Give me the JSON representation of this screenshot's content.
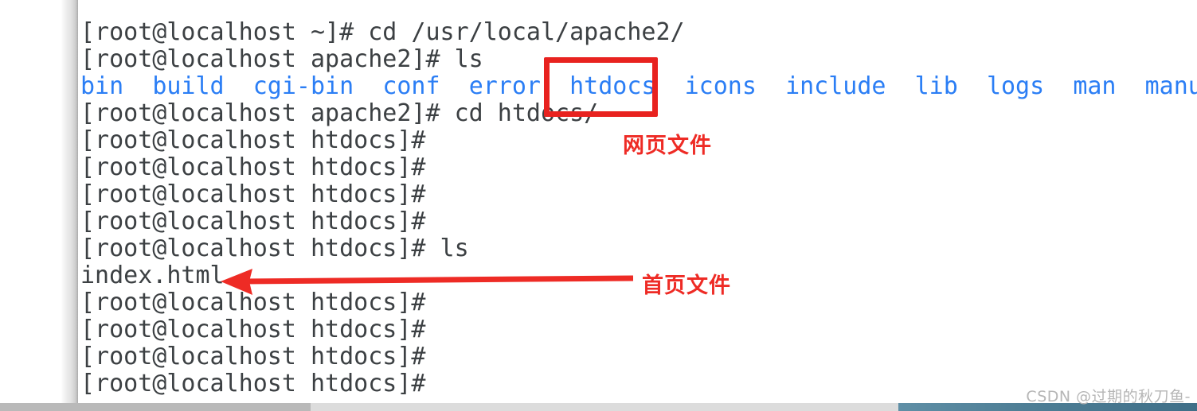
{
  "terminal": {
    "lines": [
      {
        "id": "cmd-cd-apache2",
        "type": "prompt",
        "text": "[root@localhost ~]# cd /usr/local/apache2/"
      },
      {
        "id": "cmd-ls-apache2",
        "type": "prompt",
        "text": "[root@localhost apache2]# ls"
      },
      {
        "id": "ls-output-apache2",
        "type": "listing",
        "text": "bin  build  cgi-bin  conf  error  htdocs  icons  include  lib  logs  man  manual"
      },
      {
        "id": "cmd-cd-htdocs",
        "type": "prompt",
        "text": "[root@localhost apache2]# cd htdocs/"
      },
      {
        "id": "prompt-1",
        "type": "prompt",
        "text": "[root@localhost htdocs]#"
      },
      {
        "id": "prompt-2",
        "type": "prompt",
        "text": "[root@localhost htdocs]#"
      },
      {
        "id": "prompt-3",
        "type": "prompt",
        "text": "[root@localhost htdocs]#"
      },
      {
        "id": "prompt-4",
        "type": "prompt",
        "text": "[root@localhost htdocs]#"
      },
      {
        "id": "cmd-ls-htdocs",
        "type": "prompt",
        "text": "[root@localhost htdocs]# ls"
      },
      {
        "id": "ls-output-htdocs",
        "type": "file",
        "text": "index.html"
      },
      {
        "id": "prompt-5",
        "type": "prompt",
        "text": "[root@localhost htdocs]#"
      },
      {
        "id": "prompt-6",
        "type": "prompt",
        "text": "[root@localhost htdocs]#"
      },
      {
        "id": "prompt-7",
        "type": "prompt",
        "text": "[root@localhost htdocs]#"
      },
      {
        "id": "prompt-8",
        "type": "prompt",
        "text": "[root@localhost htdocs]#"
      }
    ],
    "directory_entries": [
      "bin",
      "build",
      "cgi-bin",
      "conf",
      "error",
      "htdocs",
      "icons",
      "include",
      "lib",
      "logs",
      "man",
      "manual"
    ],
    "highlighted_entry": "htdocs",
    "file_entries": [
      "index.html"
    ],
    "colors": {
      "directory": "#2b7ef5",
      "text": "#3c4043",
      "background": "#ffffff"
    }
  },
  "annotations": {
    "box_label": "网页文件",
    "arrow_label": "首页文件",
    "color": "#ee2b25",
    "box_color": "#e8221f"
  },
  "watermark": {
    "text": "CSDN @过期的秋刀鱼-"
  }
}
